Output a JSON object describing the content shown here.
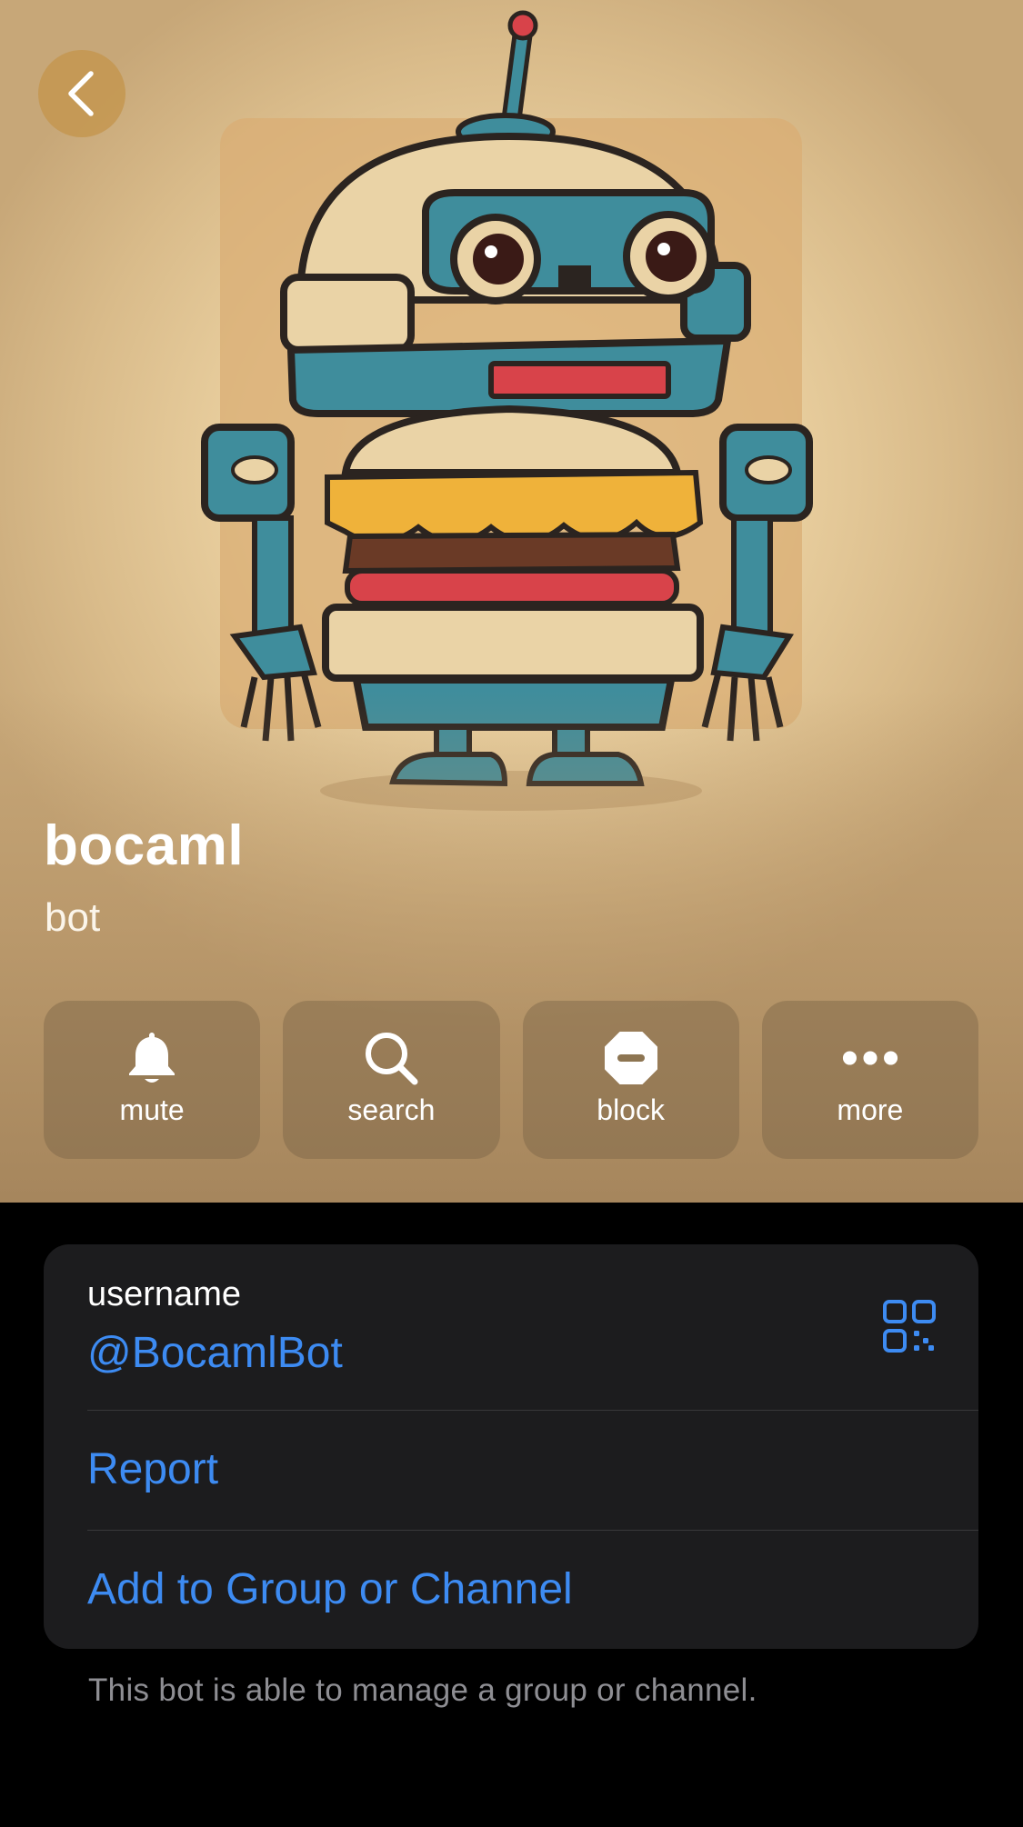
{
  "header": {
    "back_icon": "chevron-left-icon",
    "avatar_description_icon": "bot-avatar-image"
  },
  "profile": {
    "name": "bocaml",
    "subtitle": "bot"
  },
  "actions": [
    {
      "label": "mute",
      "icon": "bell-icon"
    },
    {
      "label": "search",
      "icon": "search-icon"
    },
    {
      "label": "block",
      "icon": "block-icon"
    },
    {
      "label": "more",
      "icon": "more-icon"
    }
  ],
  "info": {
    "username_caption": "username",
    "username_value": "@BocamlBot",
    "qr_icon": "qr-code-icon",
    "report_label": "Report",
    "add_label": "Add to Group or Channel"
  },
  "footer": {
    "note": "This bot is able to manage a group or channel."
  },
  "colors": {
    "accent_link": "#3d8bf2",
    "card_background": "#1c1c1e",
    "page_background": "#000000",
    "back_button": "#c49650"
  }
}
